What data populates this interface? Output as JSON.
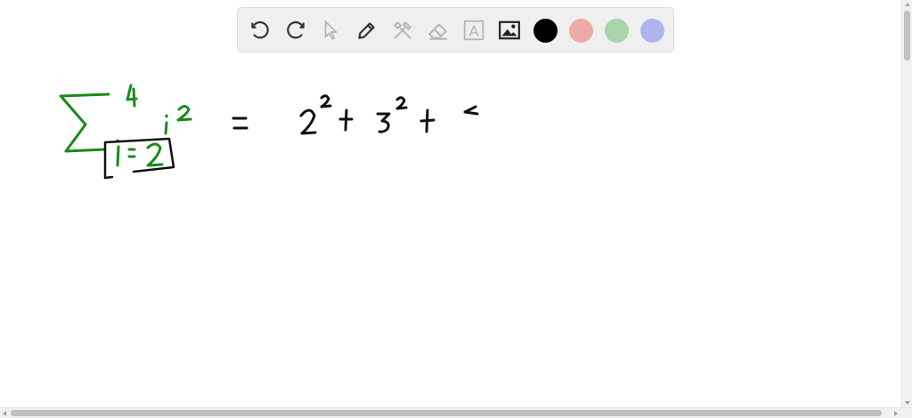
{
  "toolbar": {
    "tools": [
      {
        "name": "undo-icon"
      },
      {
        "name": "redo-icon"
      },
      {
        "name": "select-cursor-icon"
      },
      {
        "name": "pen-icon"
      },
      {
        "name": "tools-icon"
      },
      {
        "name": "eraser-icon"
      },
      {
        "name": "text-icon"
      },
      {
        "name": "image-icon"
      }
    ],
    "text_tool_label": "A",
    "colors": [
      "#000000",
      "#f0a9a9",
      "#a9d3a9",
      "#b0b4ee"
    ],
    "selected_color": "#000000"
  },
  "canvas": {
    "ink_colors": {
      "green": "#1a8a1a",
      "black": "#111111"
    }
  }
}
